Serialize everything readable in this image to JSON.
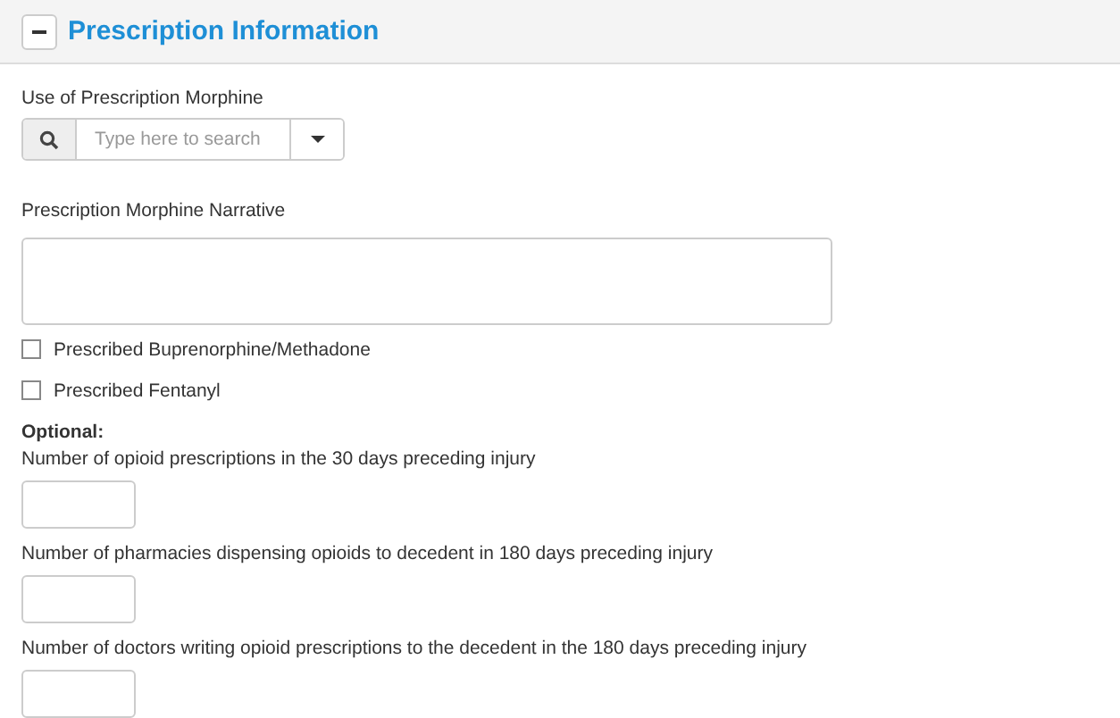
{
  "section": {
    "title": "Prescription Information",
    "expanded": true
  },
  "use_field": {
    "label": "Use of Prescription Morphine",
    "placeholder": "Type here to search"
  },
  "narrative": {
    "label": "Prescription Morphine Narrative"
  },
  "checkboxes": [
    {
      "label": "Prescribed Buprenorphine/Methadone",
      "checked": false
    },
    {
      "label": "Prescribed Fentanyl",
      "checked": false
    }
  ],
  "optional_heading": "Optional:",
  "number_fields": [
    {
      "label": "Number of opioid prescriptions in the 30 days preceding injury"
    },
    {
      "label": "Number of pharmacies dispensing opioids to decedent in 180 days preceding injury"
    },
    {
      "label": "Number of doctors writing opioid prescriptions to the decedent in the 180 days preceding injury"
    }
  ]
}
